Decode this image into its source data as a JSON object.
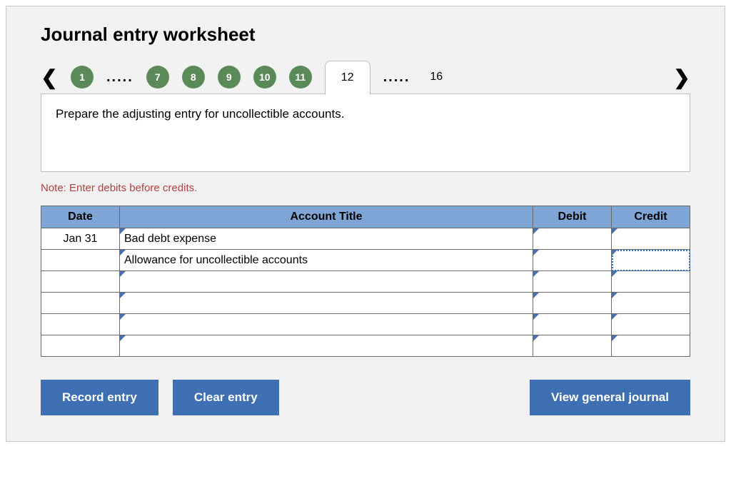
{
  "title": "Journal entry worksheet",
  "tabs": {
    "pages": [
      "1",
      "7",
      "8",
      "9",
      "10",
      "11"
    ],
    "active": "12",
    "last": "16"
  },
  "instruction": "Prepare the adjusting entry for uncollectible accounts.",
  "note": "Note: Enter debits before credits.",
  "headers": {
    "date": "Date",
    "account": "Account Title",
    "debit": "Debit",
    "credit": "Credit"
  },
  "rows": [
    {
      "date": "Jan 31",
      "account": "Bad debt expense",
      "debit": "",
      "credit": "",
      "credit_selected": false
    },
    {
      "date": "",
      "account": "Allowance for uncollectible accounts",
      "debit": "",
      "credit": "",
      "credit_selected": true
    },
    {
      "date": "",
      "account": "",
      "debit": "",
      "credit": "",
      "credit_selected": false
    },
    {
      "date": "",
      "account": "",
      "debit": "",
      "credit": "",
      "credit_selected": false
    },
    {
      "date": "",
      "account": "",
      "debit": "",
      "credit": "",
      "credit_selected": false
    },
    {
      "date": "",
      "account": "",
      "debit": "",
      "credit": "",
      "credit_selected": false
    }
  ],
  "buttons": {
    "record": "Record entry",
    "clear": "Clear entry",
    "view": "View general journal"
  }
}
